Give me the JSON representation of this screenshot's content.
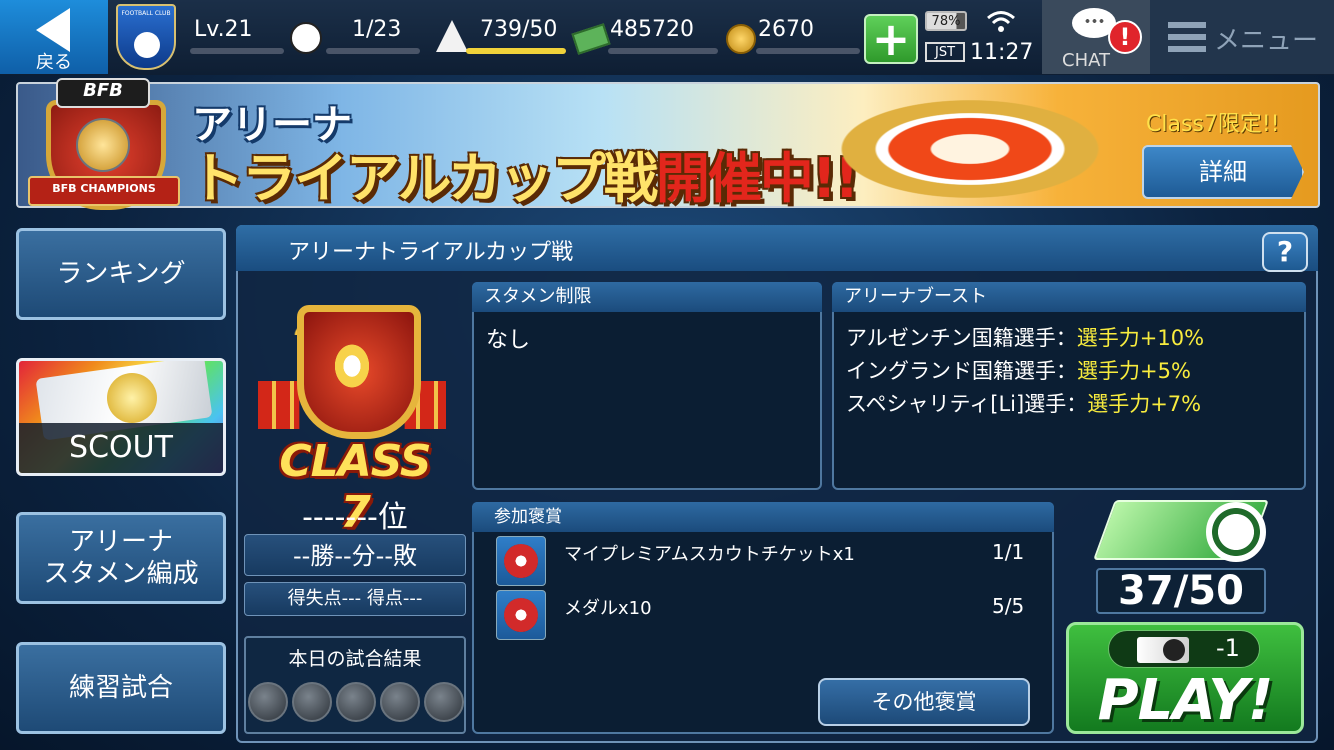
{
  "topbar": {
    "back_label": "戻る",
    "crest_text": "FOOTBALL CLUB",
    "level": "Lv.21",
    "ball_count": "1/23",
    "cone_stamina": "739/50",
    "money": "485720",
    "coins": "2670",
    "battery": "78%",
    "timezone": "JST",
    "time": "11:27",
    "chat_label": "CHAT",
    "chat_badge": "!",
    "menu_label": "メニュー"
  },
  "banner": {
    "emblem_top": "BFB",
    "emblem_ribbon": "BFB CHAMPIONS",
    "line1": "アリーナ",
    "line2_main": "トライアルカップ戦",
    "line2_red": "開催中!!",
    "class_limited": "Class7限定!!",
    "detail_button": "詳細"
  },
  "nav": {
    "ranking": "ランキング",
    "scout": "SCOUT",
    "arena_lineup_1": "アリーナ",
    "arena_lineup_2": "スタメン編成",
    "practice": "練習試合"
  },
  "main": {
    "title": "アリーナトライアルカップ戦",
    "help": "?",
    "class_label": "CLASS 7",
    "rank": "-------位",
    "record": "--勝--分--敗",
    "goals": "得失点--- 得点---",
    "today_results_title": "本日の試合結果",
    "starter_limit": {
      "header": "スタメン制限",
      "value": "なし"
    },
    "arena_boost": {
      "header": "アリーナブースト",
      "lines": [
        {
          "label": "アルゼンチン国籍選手：",
          "value": "選手力+10%"
        },
        {
          "label": "イングランド国籍選手：",
          "value": "選手力+5%"
        },
        {
          "label": "スペシャリティ[Li]選手：",
          "value": "選手力+7%"
        }
      ]
    },
    "rewards": {
      "header": "参加褒賞",
      "items": [
        {
          "name": "マイプレミアムスカウトチケットx1",
          "count": "1/1"
        },
        {
          "name": "メダルx10",
          "count": "5/5"
        }
      ],
      "other_button": "その他褒賞"
    },
    "stamina": "37/50",
    "play_cost": "-1",
    "play_label": "PLAY!"
  }
}
